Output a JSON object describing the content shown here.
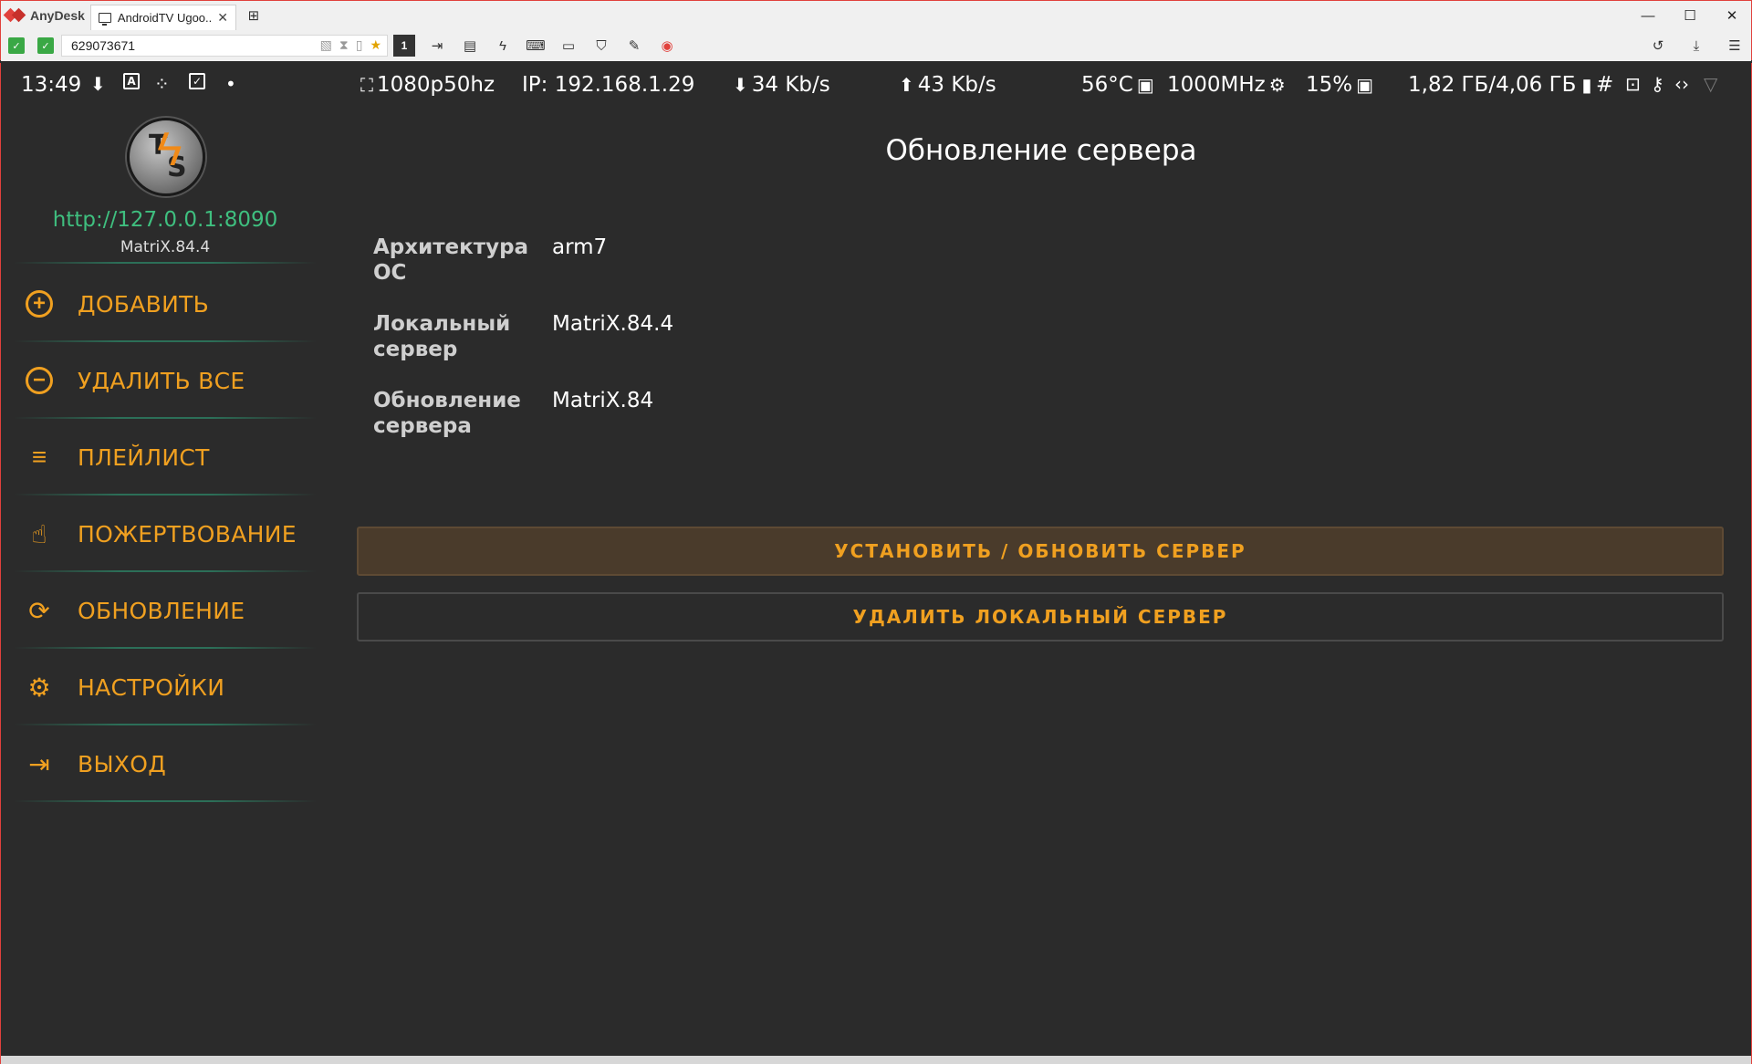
{
  "app": {
    "brand": "AnyDesk",
    "tab_title": "AndroidTV Ugoo...",
    "address": "629073671",
    "session_number": "1"
  },
  "statusbar": {
    "time": "13:49",
    "resolution": "1080p50hz",
    "ip": "IP: 192.168.1.29",
    "download": "34 Kb/s",
    "upload": "43 Kb/s",
    "temp": "56°C",
    "cpu": "1000MHz",
    "load": "15%",
    "ram": "1,82 ГБ/4,06 ГБ"
  },
  "sidebar": {
    "server_url": "http://127.0.0.1:8090",
    "server_version": "MatriX.84.4",
    "items": [
      {
        "label": "ДОБАВИТЬ",
        "icon": "plus-circle-icon"
      },
      {
        "label": "УДАЛИТЬ ВСЕ",
        "icon": "minus-circle-icon"
      },
      {
        "label": "ПЛЕЙЛИСТ",
        "icon": "playlist-icon"
      },
      {
        "label": "ПОЖЕРТВОВАНИЕ",
        "icon": "thumbs-up-icon"
      },
      {
        "label": "ОБНОВЛЕНИЕ",
        "icon": "refresh-icon"
      },
      {
        "label": "НАСТРОЙКИ",
        "icon": "gear-icon"
      },
      {
        "label": "ВЫХОД",
        "icon": "exit-icon"
      }
    ]
  },
  "main": {
    "title": "Обновление сервера",
    "info": [
      {
        "key_line1": "Архитектура",
        "key_line2": "ОС",
        "value": "arm7"
      },
      {
        "key_line1": "Локальный",
        "key_line2": "сервер",
        "value": "MatriX.84.4"
      },
      {
        "key_line1": "Обновление",
        "key_line2": "сервера",
        "value": "MatriX.84"
      }
    ],
    "install_button": "УСТАНОВИТЬ / ОБНОВИТЬ СЕРВЕР",
    "remove_button": "УДАЛИТЬ ЛОКАЛЬНЫЙ СЕРВЕР"
  },
  "colors": {
    "accent": "#f0a020",
    "url_green": "#3fbf7f",
    "background": "#2b2b2b",
    "anydesk_red": "#e1413c"
  }
}
